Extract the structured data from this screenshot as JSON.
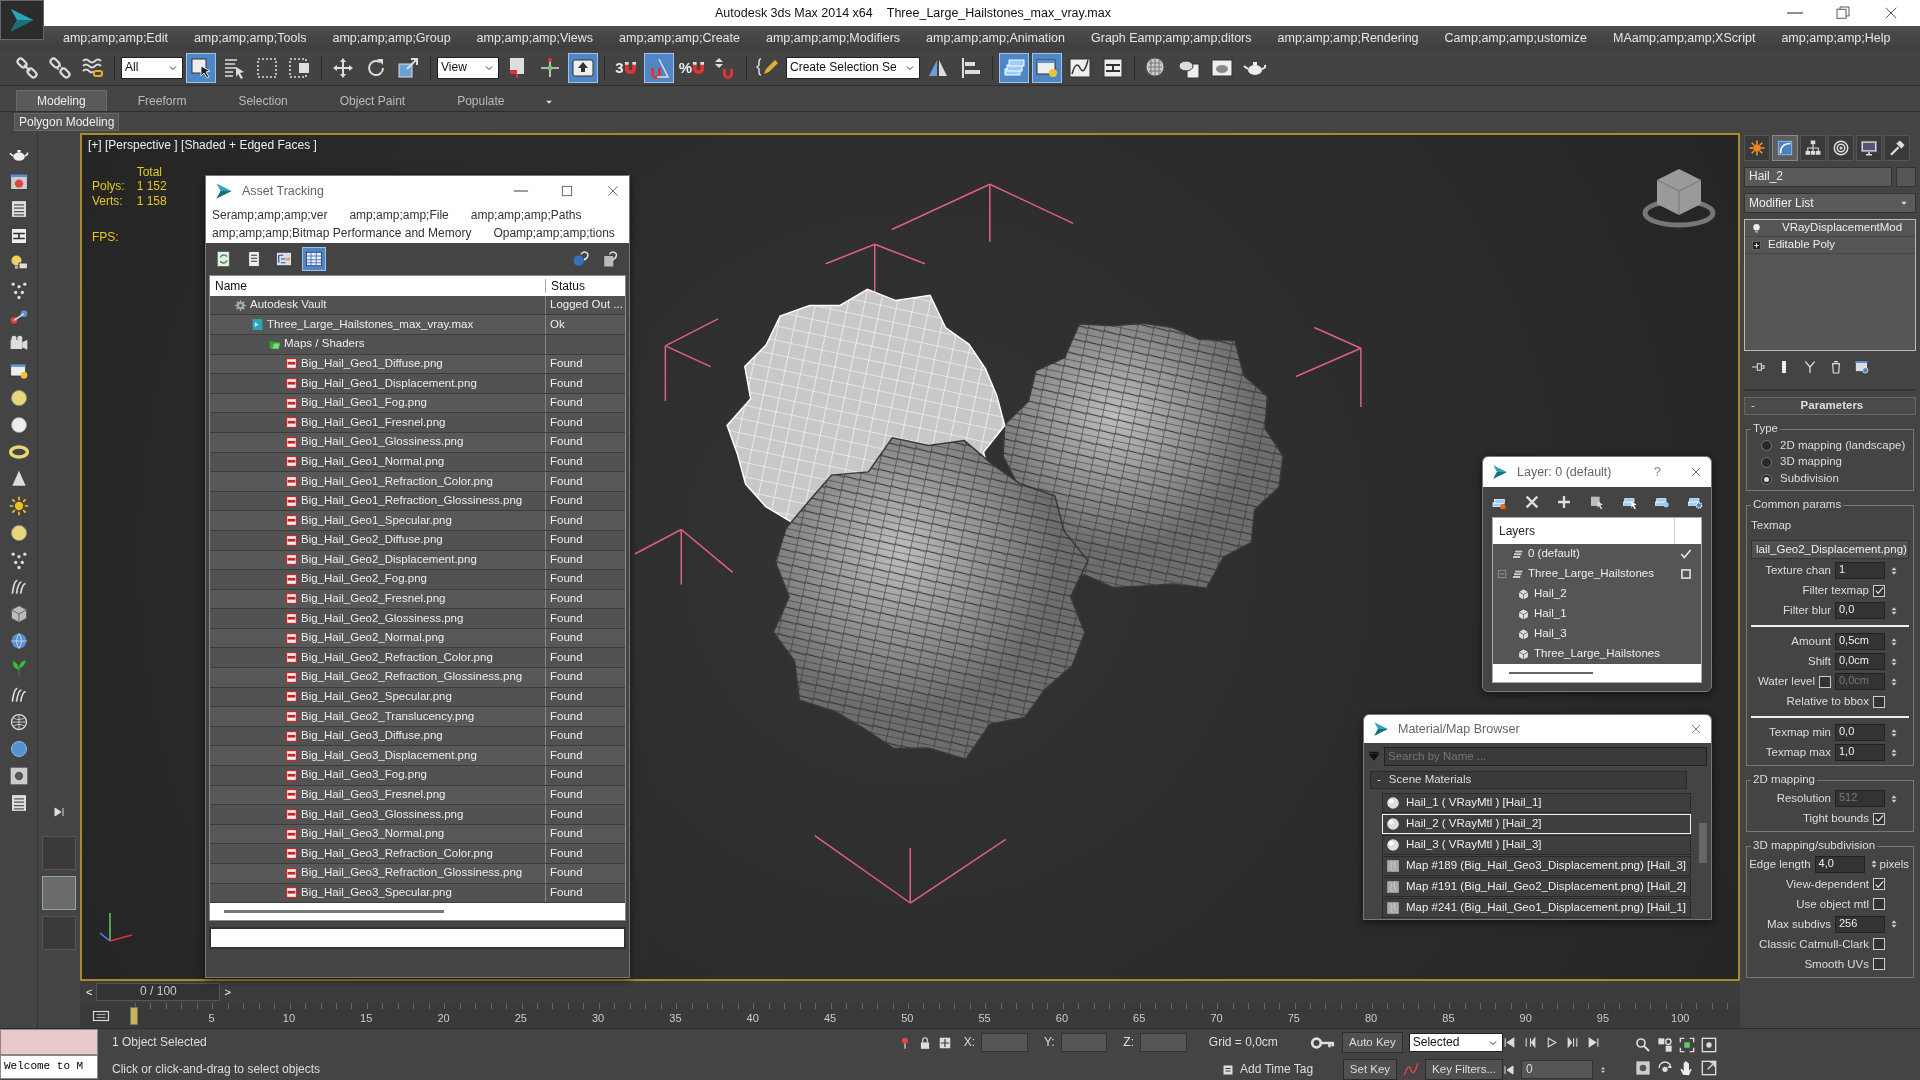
{
  "titlebar": {
    "app": "Autodesk 3ds Max  2014 x64",
    "file": "Three_Large_Hailstones_max_vray.max"
  },
  "menu": [
    "amp;amp;amp;Edit",
    "amp;amp;amp;Tools",
    "amp;amp;amp;Group",
    "amp;amp;amp;Views",
    "amp;amp;amp;Create",
    "amp;amp;amp;Modifiers",
    "amp;amp;amp;Animation",
    "Graph Eamp;amp;amp;ditors",
    "amp;amp;amp;Rendering",
    "Camp;amp;amp;ustomize",
    "MAamp;amp;amp;XScript",
    "amp;amp;amp;Help"
  ],
  "toolbar": [
    {
      "kind": "link",
      "selected": false
    },
    {
      "kind": "unlink",
      "selected": false
    },
    {
      "kind": "bind",
      "selected": false
    },
    {
      "kind": "dropdown",
      "value": "All"
    },
    {
      "kind": "select",
      "selected": true
    },
    {
      "kind": "byname",
      "selected": false
    },
    {
      "kind": "region",
      "selected": false
    },
    {
      "kind": "crossing",
      "selected": false
    },
    {
      "kind": "move",
      "selected": false
    },
    {
      "kind": "rotate",
      "selected": false
    },
    {
      "kind": "scale",
      "selected": false
    },
    {
      "kind": "dropdown",
      "value": "View"
    },
    {
      "kind": "pivot",
      "selected": false
    },
    {
      "kind": "manip",
      "selected": false
    },
    {
      "kind": "keyboard",
      "selected": true
    },
    {
      "kind": "snap",
      "label": "3",
      "selected": false
    },
    {
      "kind": "angle",
      "selected": true
    },
    {
      "kind": "snap",
      "label": "%",
      "selected": false
    },
    {
      "kind": "spinner",
      "selected": false
    },
    {
      "kind": "pencil",
      "selected": false
    },
    {
      "kind": "dropdown",
      "value": "Create Selection Se"
    },
    {
      "kind": "mirror",
      "selected": false
    },
    {
      "kind": "align",
      "selected": false
    },
    {
      "kind": "layers",
      "selected": true
    },
    {
      "kind": "explorer",
      "selected": true
    },
    {
      "kind": "curve",
      "selected": false
    },
    {
      "kind": "schematic",
      "selected": false
    },
    {
      "kind": "material",
      "selected": false
    },
    {
      "kind": "rsetup",
      "selected": false
    },
    {
      "kind": "rframe",
      "selected": false
    },
    {
      "kind": "render",
      "selected": false
    }
  ],
  "ribbon": {
    "tabs": [
      {
        "label": "Modeling",
        "selected": true
      },
      {
        "label": "Freeform",
        "selected": false
      },
      {
        "label": "Selection",
        "selected": false
      },
      {
        "label": "Object Paint",
        "selected": false
      },
      {
        "label": "Populate",
        "selected": false
      }
    ],
    "panel": "Polygon Modeling"
  },
  "viewport": {
    "label": "[+] [Perspective ] [Shaded + Edged Faces ]",
    "stats_header": "Total",
    "stats": [
      {
        "label": "Polys:",
        "value": "1 152"
      },
      {
        "label": "Verts:",
        "value": "1 158"
      }
    ],
    "fps": "FPS:"
  },
  "asset_tracking": {
    "title": "Asset Tracking",
    "menu": [
      "Seramp;amp;amp;ver",
      "amp;amp;amp;File",
      "amp;amp;amp;Paths",
      "amp;amp;amp;Bitmap Performance and Memory",
      "Opamp;amp;amp;tions"
    ],
    "tools": [
      {
        "kind": "refresh",
        "selected": false
      },
      {
        "kind": "list",
        "selected": false
      },
      {
        "kind": "tree",
        "selected": false
      },
      {
        "kind": "table",
        "selected": true
      }
    ],
    "columns": [
      "Name",
      "Status"
    ],
    "tree": [
      {
        "name": "Autodesk Vault",
        "status": "Logged Out ...",
        "kind": "vault",
        "children": [
          {
            "name": "Three_Large_Hailstones_max_vray.max",
            "status": "Ok",
            "kind": "max",
            "children": [
              {
                "name": "Maps / Shaders",
                "kind": "folder",
                "children": [
                  {
                    "name": "Big_Hail_Geo1_Diffuse.png",
                    "status": "Found",
                    "kind": "png"
                  },
                  {
                    "name": "Big_Hail_Geo1_Displacement.png",
                    "status": "Found",
                    "kind": "png"
                  },
                  {
                    "name": "Big_Hail_Geo1_Fog.png",
                    "status": "Found",
                    "kind": "png"
                  },
                  {
                    "name": "Big_Hail_Geo1_Fresnel.png",
                    "status": "Found",
                    "kind": "png"
                  },
                  {
                    "name": "Big_Hail_Geo1_Glossiness.png",
                    "status": "Found",
                    "kind": "png"
                  },
                  {
                    "name": "Big_Hail_Geo1_Normal.png",
                    "status": "Found",
                    "kind": "png"
                  },
                  {
                    "name": "Big_Hail_Geo1_Refraction_Color.png",
                    "status": "Found",
                    "kind": "png"
                  },
                  {
                    "name": "Big_Hail_Geo1_Refraction_Glossiness.png",
                    "status": "Found",
                    "kind": "png"
                  },
                  {
                    "name": "Big_Hail_Geo1_Specular.png",
                    "status": "Found",
                    "kind": "png"
                  },
                  {
                    "name": "Big_Hail_Geo2_Diffuse.png",
                    "status": "Found",
                    "kind": "png"
                  },
                  {
                    "name": "Big_Hail_Geo2_Displacement.png",
                    "status": "Found",
                    "kind": "png"
                  },
                  {
                    "name": "Big_Hail_Geo2_Fog.png",
                    "status": "Found",
                    "kind": "png"
                  },
                  {
                    "name": "Big_Hail_Geo2_Fresnel.png",
                    "status": "Found",
                    "kind": "png"
                  },
                  {
                    "name": "Big_Hail_Geo2_Glossiness.png",
                    "status": "Found",
                    "kind": "png"
                  },
                  {
                    "name": "Big_Hail_Geo2_Normal.png",
                    "status": "Found",
                    "kind": "png"
                  },
                  {
                    "name": "Big_Hail_Geo2_Refraction_Color.png",
                    "status": "Found",
                    "kind": "png"
                  },
                  {
                    "name": "Big_Hail_Geo2_Refraction_Glossiness.png",
                    "status": "Found",
                    "kind": "png"
                  },
                  {
                    "name": "Big_Hail_Geo2_Specular.png",
                    "status": "Found",
                    "kind": "png"
                  },
                  {
                    "name": "Big_Hail_Geo2_Translucency.png",
                    "status": "Found",
                    "kind": "png"
                  },
                  {
                    "name": "Big_Hail_Geo3_Diffuse.png",
                    "status": "Found",
                    "kind": "png"
                  },
                  {
                    "name": "Big_Hail_Geo3_Displacement.png",
                    "status": "Found",
                    "kind": "png"
                  },
                  {
                    "name": "Big_Hail_Geo3_Fog.png",
                    "status": "Found",
                    "kind": "png"
                  },
                  {
                    "name": "Big_Hail_Geo3_Fresnel.png",
                    "status": "Found",
                    "kind": "png"
                  },
                  {
                    "name": "Big_Hail_Geo3_Glossiness.png",
                    "status": "Found",
                    "kind": "png"
                  },
                  {
                    "name": "Big_Hail_Geo3_Normal.png",
                    "status": "Found",
                    "kind": "png"
                  },
                  {
                    "name": "Big_Hail_Geo3_Refraction_Color.png",
                    "status": "Found",
                    "kind": "png"
                  },
                  {
                    "name": "Big_Hail_Geo3_Refraction_Glossiness.png",
                    "status": "Found",
                    "kind": "png"
                  },
                  {
                    "name": "Big_Hail_Geo3_Specular.png",
                    "status": "Found",
                    "kind": "png"
                  }
                ]
              }
            ]
          }
        ]
      }
    ]
  },
  "layer_dialog": {
    "title": "Layer: 0 (default)",
    "help": "?",
    "header": "Layers",
    "tree": [
      {
        "name": "0 (default)",
        "kind": "layer",
        "current": true
      },
      {
        "name": "Three_Large_Hailstones",
        "kind": "layer",
        "current": false,
        "expanded": true,
        "children": [
          {
            "name": "Hail_2",
            "kind": "object"
          },
          {
            "name": "Hail_1",
            "kind": "object"
          },
          {
            "name": "Hail_3",
            "kind": "object"
          },
          {
            "name": "Three_Large_Hailstones",
            "kind": "object"
          }
        ]
      }
    ]
  },
  "material_browser": {
    "title": "Material/Map Browser",
    "placeholder": "Search by Name ...",
    "group_toggle": "-",
    "group": "Scene Materials",
    "items": [
      {
        "label": "Hail_1  ( VRayMtl ) [Hail_1]",
        "kind": "material",
        "selected": false
      },
      {
        "label": "Hail_2  ( VRayMtl ) [Hail_2]",
        "kind": "material",
        "selected": true
      },
      {
        "label": "Hail_3  ( VRayMtl ) [Hail_3]",
        "kind": "material",
        "selected": false
      },
      {
        "label": "Map #189 (Big_Hail_Geo3_Displacement.png) [Hail_3]",
        "kind": "map",
        "selected": false
      },
      {
        "label": "Map #191 (Big_Hail_Geo2_Displacement.png) [Hail_2]",
        "kind": "map",
        "selected": false
      },
      {
        "label": "Map #241 (Big_Hail_Geo1_Displacement.png) [Hail_1]",
        "kind": "map",
        "selected": false
      }
    ]
  },
  "command_panel": {
    "tabs": [
      {
        "kind": "create",
        "selected": false
      },
      {
        "kind": "modify",
        "selected": true
      },
      {
        "kind": "hierarchy",
        "selected": false
      },
      {
        "kind": "motion",
        "selected": false
      },
      {
        "kind": "display",
        "selected": false
      },
      {
        "kind": "utilities",
        "selected": false
      }
    ],
    "object_name": "Hail_2",
    "modifier_list": "Modifier List",
    "stack": [
      {
        "label": "VRayDisplacementMod",
        "kind": "modifier"
      },
      {
        "label": "Editable Poly",
        "kind": "base"
      }
    ],
    "rollout_toggle": "-",
    "rollout": "Parameters",
    "groups": [
      {
        "label": "Type",
        "items": [
          {
            "kind": "radio",
            "label": "2D mapping (landscape)",
            "selected": false
          },
          {
            "kind": "radio",
            "label": "3D mapping",
            "selected": false
          },
          {
            "kind": "radio",
            "label": "Subdivision",
            "selected": true
          }
        ]
      },
      {
        "label": "Common params",
        "items": [
          {
            "kind": "text",
            "label": "Texmap"
          },
          {
            "kind": "map",
            "label": "lail_Geo2_Displacement.png)"
          },
          {
            "kind": "spinner",
            "label": "Texture chan",
            "value": "1",
            "disabled": false
          },
          {
            "kind": "check",
            "label": "Filter texmap",
            "checked": true
          },
          {
            "kind": "spinner",
            "label": "Filter blur",
            "value": "0,0",
            "disabled": false
          },
          {
            "kind": "rule"
          },
          {
            "kind": "spinner",
            "label": "Amount",
            "value": "0,5cm",
            "disabled": false
          },
          {
            "kind": "spinner",
            "label": "Shift",
            "value": "0,0cm",
            "disabled": false
          },
          {
            "kind": "spinner",
            "label": "Water level",
            "value": "0,0cm",
            "disabled": true,
            "checked": false
          },
          {
            "kind": "check",
            "label": "Relative to bbox",
            "checked": false
          },
          {
            "kind": "rule"
          },
          {
            "kind": "spinner",
            "label": "Texmap min",
            "value": "0,0",
            "disabled": false
          },
          {
            "kind": "spinner",
            "label": "Texmap max",
            "value": "1,0",
            "disabled": false
          }
        ]
      },
      {
        "label": "2D mapping",
        "items": [
          {
            "kind": "spinner",
            "label": "Resolution",
            "value": "512",
            "disabled": true
          },
          {
            "kind": "check",
            "label": "Tight bounds",
            "checked": true
          }
        ]
      },
      {
        "label": "3D mapping/subdivision",
        "items": [
          {
            "kind": "spinner",
            "label": "Edge length",
            "value": "4,0",
            "unit": "pixels",
            "disabled": false
          },
          {
            "kind": "check",
            "label": "View-dependent",
            "checked": true
          },
          {
            "kind": "check",
            "label": "Use object mtl",
            "checked": false
          },
          {
            "kind": "spinner",
            "label": "Max subdivs",
            "value": "256",
            "disabled": false
          },
          {
            "kind": "check",
            "label": "Classic Catmull-Clark",
            "checked": false
          },
          {
            "kind": "check",
            "label": "Smooth UVs",
            "checked": false
          }
        ]
      }
    ]
  },
  "timeline": {
    "prev": "<",
    "frame": "0 / 100",
    "next": ">",
    "ticks": [
      "5",
      "10",
      "15",
      "20",
      "25",
      "30",
      "35",
      "40",
      "45",
      "50",
      "55",
      "60",
      "65",
      "70",
      "75",
      "80",
      "85",
      "90",
      "95",
      "100"
    ]
  },
  "status": {
    "listener": "Welcome to M",
    "selection": "1 Object Selected",
    "prompt": "Click or click-and-drag to select objects",
    "coords": [
      "X:",
      "Y:",
      "Z:"
    ],
    "grid": "Grid = 0,0cm",
    "time_tag": "Add Time Tag",
    "auto_key": "Auto Key",
    "key_mode": "Selected",
    "set_key": "Set Key",
    "key_filters": "Key Filters...",
    "frame": "0"
  }
}
